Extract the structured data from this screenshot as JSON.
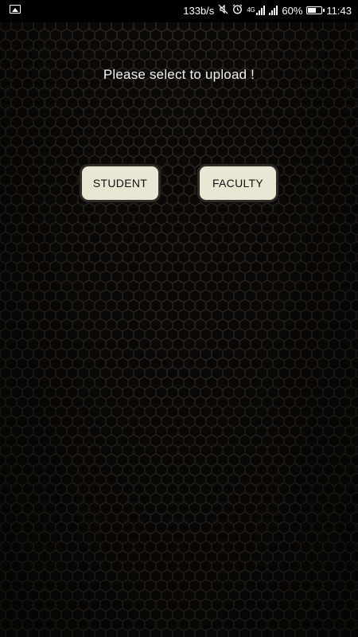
{
  "status_bar": {
    "net_speed": "133b/s",
    "network_type": "4G",
    "battery_percent": "60%",
    "time": "11:43",
    "icons": [
      "gallery-icon",
      "mute-vibrate-icon",
      "alarm-icon",
      "wifi-icon",
      "signal-icon",
      "battery-icon"
    ]
  },
  "main": {
    "prompt": "Please select to upload !",
    "buttons": {
      "student": "STUDENT",
      "faculty": "FACULTY"
    }
  },
  "colors": {
    "background": "#0b0a09",
    "hex_pattern": "#352a22",
    "button_fill": "#e9e6d3",
    "button_border": "#2f2b27",
    "text": "#f2f2f2"
  }
}
